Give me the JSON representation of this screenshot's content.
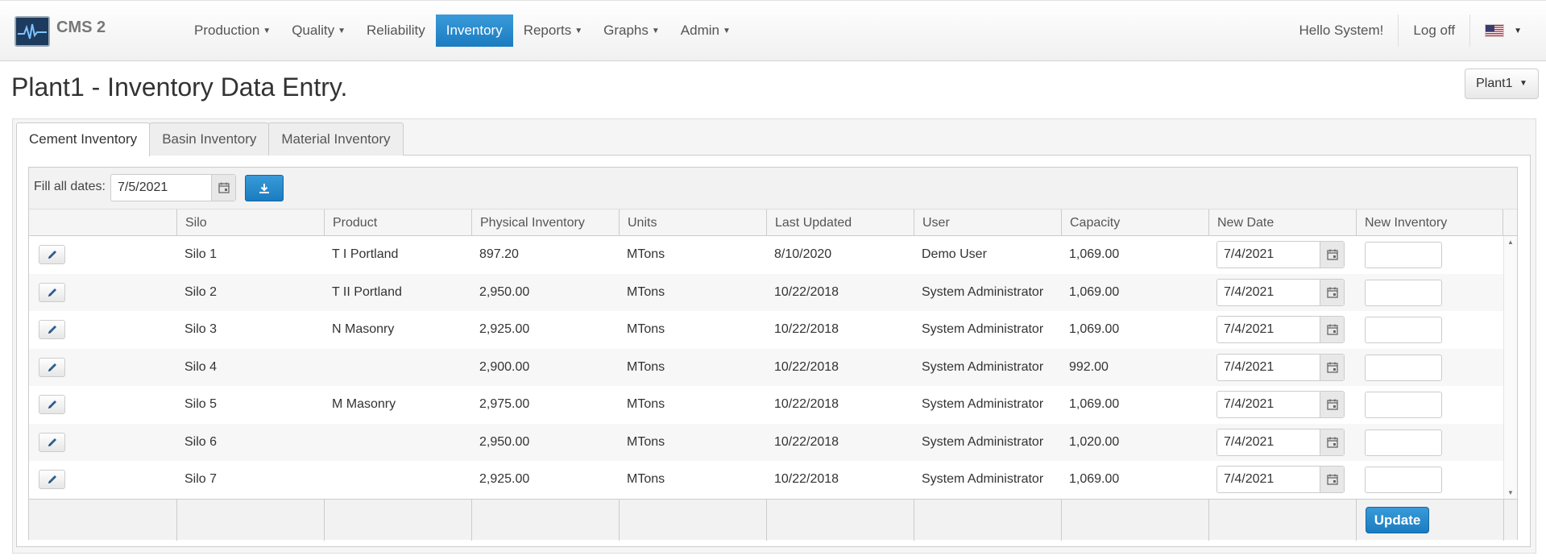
{
  "app": {
    "brand": "CMS 2"
  },
  "nav": {
    "items": [
      {
        "label": "Production",
        "caret": true
      },
      {
        "label": "Quality",
        "caret": true
      },
      {
        "label": "Reliability",
        "caret": false
      },
      {
        "label": "Inventory",
        "caret": false,
        "active": true
      },
      {
        "label": "Reports",
        "caret": true
      },
      {
        "label": "Graphs",
        "caret": true
      },
      {
        "label": "Admin",
        "caret": true
      }
    ],
    "greeting": "Hello System!",
    "logoff": "Log off",
    "language_icon": "us-flag-icon"
  },
  "page": {
    "title": "Plant1 - Inventory Data Entry.",
    "plant_selector": "Plant1"
  },
  "tabs": [
    "Cement Inventory",
    "Basin Inventory",
    "Material Inventory"
  ],
  "toolbar": {
    "fill_label": "Fill all dates:",
    "fill_date": "7/5/2021"
  },
  "table": {
    "columns": [
      "",
      "Silo",
      "Product",
      "Physical Inventory",
      "Units",
      "Last Updated",
      "User",
      "Capacity",
      "New Date",
      "New Inventory"
    ],
    "rows": [
      {
        "silo": "Silo 1",
        "product": "T I Portland",
        "physical": "897.20",
        "units": "MTons",
        "updated": "8/10/2020",
        "user": "Demo User",
        "capacity": "1,069.00",
        "new_date": "7/4/2021",
        "new_inventory": ""
      },
      {
        "silo": "Silo 2",
        "product": "T II Portland",
        "physical": "2,950.00",
        "units": "MTons",
        "updated": "10/22/2018",
        "user": "System Administrator",
        "capacity": "1,069.00",
        "new_date": "7/4/2021",
        "new_inventory": ""
      },
      {
        "silo": "Silo 3",
        "product": "N Masonry",
        "physical": "2,925.00",
        "units": "MTons",
        "updated": "10/22/2018",
        "user": "System Administrator",
        "capacity": "1,069.00",
        "new_date": "7/4/2021",
        "new_inventory": ""
      },
      {
        "silo": "Silo 4",
        "product": "",
        "physical": "2,900.00",
        "units": "MTons",
        "updated": "10/22/2018",
        "user": "System Administrator",
        "capacity": "992.00",
        "new_date": "7/4/2021",
        "new_inventory": ""
      },
      {
        "silo": "Silo 5",
        "product": "M Masonry",
        "physical": "2,975.00",
        "units": "MTons",
        "updated": "10/22/2018",
        "user": "System Administrator",
        "capacity": "1,069.00",
        "new_date": "7/4/2021",
        "new_inventory": ""
      },
      {
        "silo": "Silo 6",
        "product": "",
        "physical": "2,950.00",
        "units": "MTons",
        "updated": "10/22/2018",
        "user": "System Administrator",
        "capacity": "1,020.00",
        "new_date": "7/4/2021",
        "new_inventory": ""
      },
      {
        "silo": "Silo 7",
        "product": "",
        "physical": "2,925.00",
        "units": "MTons",
        "updated": "10/22/2018",
        "user": "System Administrator",
        "capacity": "1,069.00",
        "new_date": "7/4/2021",
        "new_inventory": ""
      }
    ]
  },
  "footer": {
    "update_label": "Update"
  },
  "colors": {
    "accent": "#1c84c6",
    "header_bg": "#f5f5f5"
  }
}
